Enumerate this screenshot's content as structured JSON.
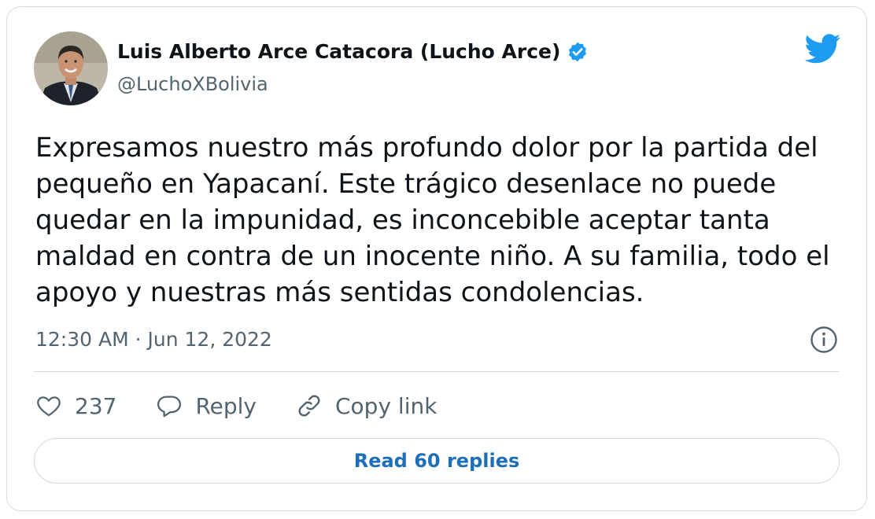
{
  "author": {
    "name": "Luis Alberto Arce Catacora (Lucho Arce)",
    "handle": "@LuchoXBolivia",
    "verified": true,
    "avatar_icon": "person-photo-icon"
  },
  "tweet": {
    "text": "Expresamos nuestro más profundo dolor por la partida del pequeño en Yapacaní. Este trágico desenlace no puede quedar en la impunidad, es inconcebible aceptar tanta maldad en contra de un inocente niño. A su familia, todo el apoyo y nuestras más sentidas condolencias.",
    "timestamp": "12:30 AM · Jun 12, 2022"
  },
  "actions": {
    "like_count": "237",
    "reply_label": "Reply",
    "copy_link_label": "Copy link"
  },
  "read_replies_label": "Read 60 replies",
  "colors": {
    "twitter_blue": "#1d9bf0",
    "link_blue": "#1d6fb8",
    "text_primary": "#0f1419",
    "text_secondary": "#536471",
    "border": "#d6dbe0"
  }
}
